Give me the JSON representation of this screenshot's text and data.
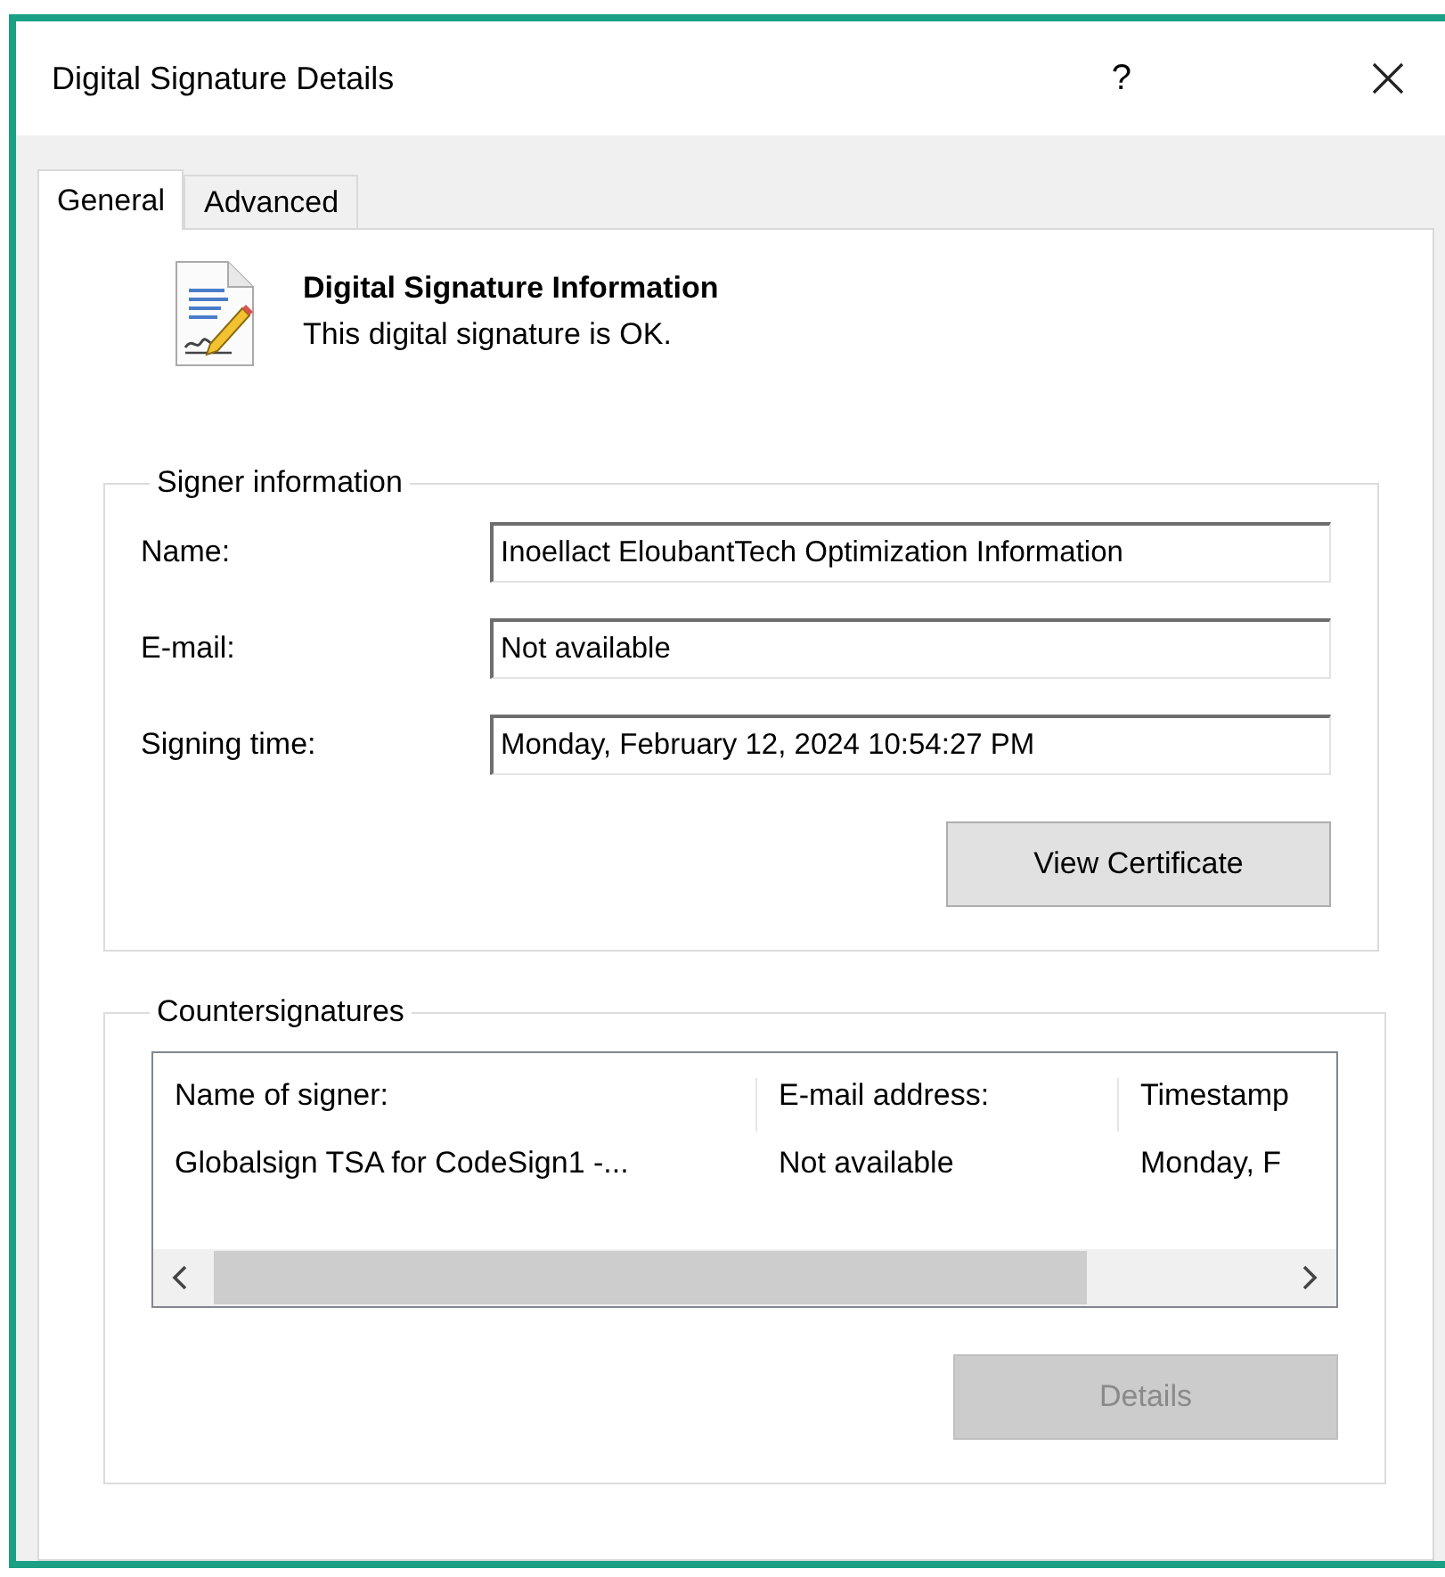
{
  "window": {
    "title": "Digital Signature Details",
    "help": "?"
  },
  "tabs": [
    {
      "label": "General",
      "selected": true
    },
    {
      "label": "Advanced",
      "selected": false
    }
  ],
  "header": {
    "title": "Digital Signature Information",
    "status": "This digital signature is OK."
  },
  "signer_information": {
    "title": "Signer information",
    "fields": [
      {
        "label": "Name:",
        "value": "Inoellact EloubantTech Optimization Information"
      },
      {
        "label": "E-mail:",
        "value": "Not available"
      },
      {
        "label": "Signing time:",
        "value": "Monday, February  12, 2024 10:54:27 PM"
      }
    ],
    "button": {
      "label": "View Certificate",
      "disabled": false
    }
  },
  "countersignatures": {
    "title": "Countersignatures",
    "table": {
      "columns": [
        "Name of signer:",
        "E-mail address:",
        "Timestamp"
      ],
      "rows": [
        [
          "Globalsign TSA for CodeSign1 -...",
          "Not available",
          "Monday, F"
        ]
      ]
    },
    "button": {
      "label": "Details",
      "disabled": true
    }
  }
}
